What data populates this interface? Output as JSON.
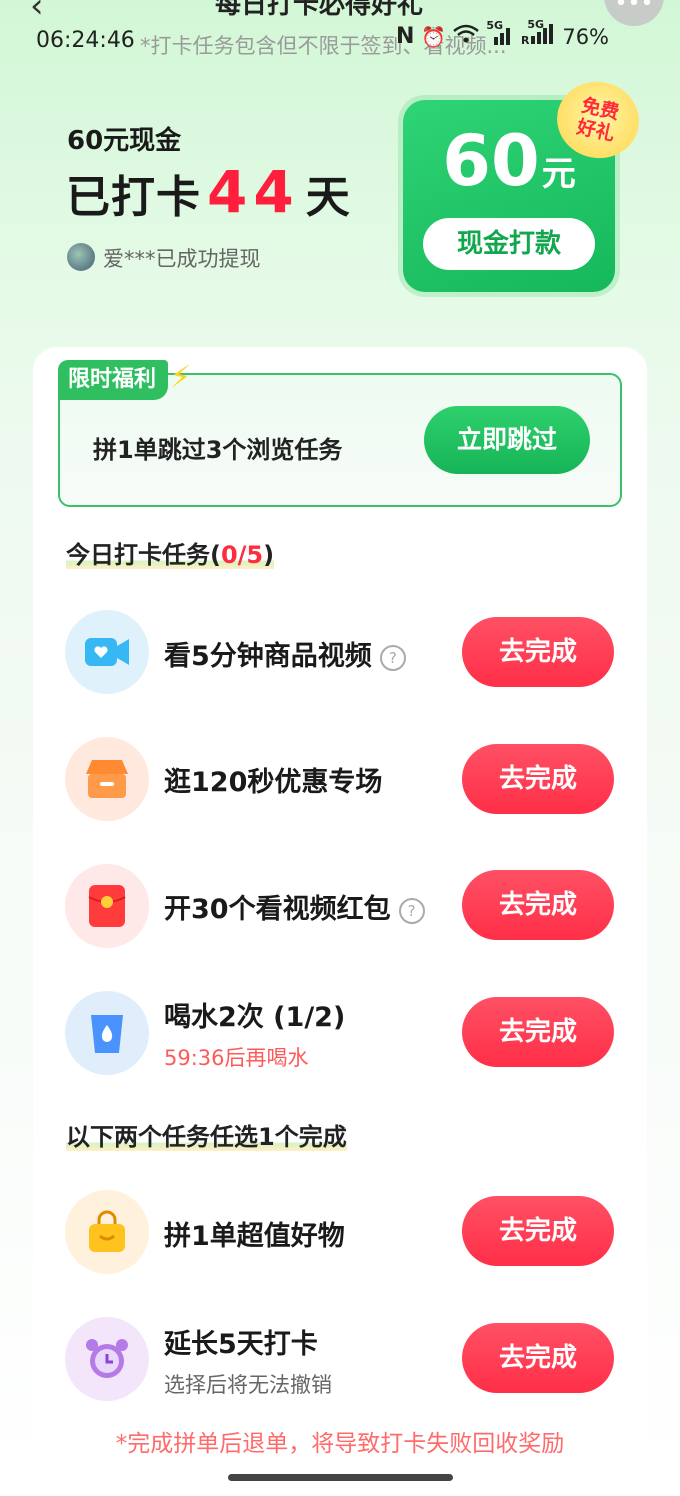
{
  "page": {
    "title": "每日打卡必得好礼"
  },
  "status_bar": {
    "time": "06:24:46",
    "ticker": "*打卡任务包含但不限于签到、看视频...",
    "battery": "76%",
    "net1": "5G",
    "net2": "5G"
  },
  "header": {
    "cash_label": "60元现金",
    "streak_prefix": "已打卡",
    "streak_days": "44",
    "streak_suffix": "天",
    "withdraw_text": "爱***已成功提现"
  },
  "reward_card": {
    "amount": "60",
    "unit": "元",
    "button": "现金打款",
    "badge": "免费好礼"
  },
  "promo": {
    "tag": "限时福利",
    "text": "拼1单跳过3个浏览任务",
    "button": "立即跳过"
  },
  "today_section": {
    "title": "今日打卡任务(",
    "done": "0/5",
    "close": ")"
  },
  "tasks": [
    {
      "title": "看5分钟商品视频",
      "button": "去完成"
    },
    {
      "title": "逛120秒优惠专场",
      "button": "去完成"
    },
    {
      "title": "开30个看视频红包",
      "button": "去完成"
    },
    {
      "title": "喝水2次 (1/2)",
      "sub": "59:36后再喝水",
      "button": "去完成"
    }
  ],
  "choice_section": {
    "title": "以下两个任务任选1个完成"
  },
  "choice_tasks": [
    {
      "title": "拼1单超值好物",
      "button": "去完成"
    },
    {
      "title": "延长5天打卡",
      "sub": "选择后将无法撤销",
      "button": "去完成"
    }
  ],
  "footer_note": "*完成拼单后退单，将导致打卡失败回收奖励",
  "colors": {
    "accent_green": "#16b457",
    "accent_red": "#ff2f48",
    "streak_red": "#ff1f3d"
  }
}
